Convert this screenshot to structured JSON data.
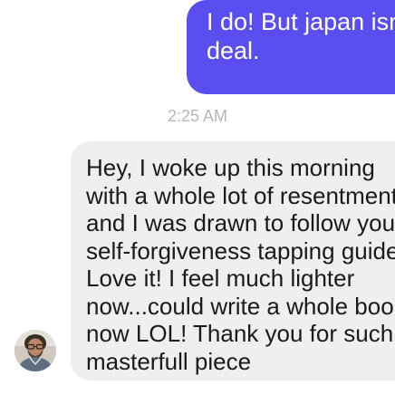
{
  "outgoing_message": {
    "lines": [
      "I do! But japan isn't",
      "deal."
    ]
  },
  "timestamp": "2:25 AM",
  "incoming_message": {
    "lines": [
      "Hey, I woke up this morning",
      "with a whole lot of resentment,",
      "and I was drawn to follow your",
      "self-forgiveness tapping guide!",
      "Love it! I feel much lighter",
      "now...could write a whole book",
      "now LOL! Thank you for such",
      "masterfull piece"
    ]
  },
  "colors": {
    "outgoing_bubble": "#5b4ef0",
    "incoming_bubble": "#efefef",
    "timestamp_text": "#b7b7b7"
  },
  "icons": {
    "avatar": "sender-avatar"
  }
}
